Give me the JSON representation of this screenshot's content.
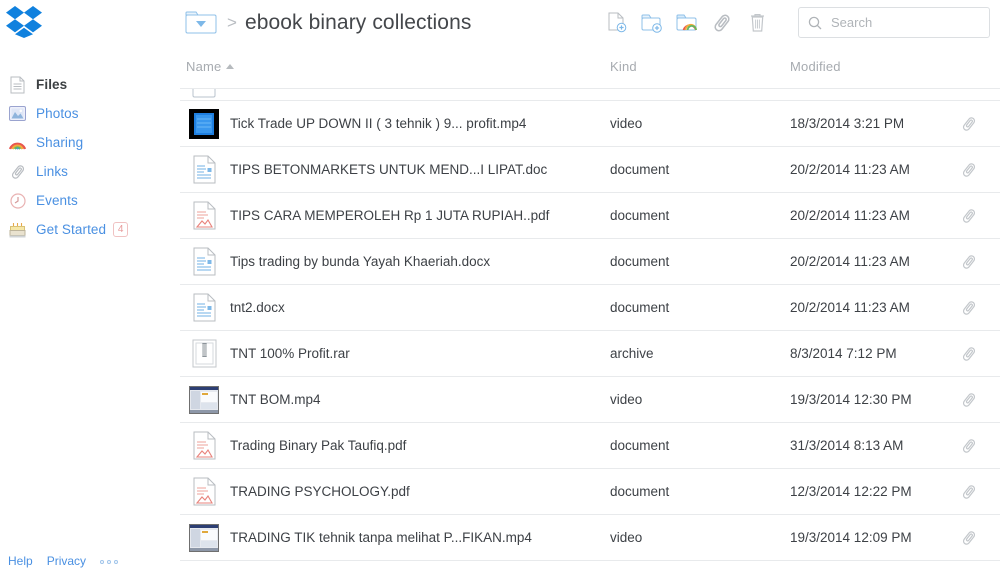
{
  "app": {
    "name": "Dropbox",
    "logo_icon": "dropbox-logo"
  },
  "sidebar": {
    "items": [
      {
        "label": "Files",
        "icon": "file-lines-icon",
        "active": true,
        "badge": null
      },
      {
        "label": "Photos",
        "icon": "photo-icon",
        "active": false,
        "badge": null
      },
      {
        "label": "Sharing",
        "icon": "rainbow-icon",
        "active": false,
        "badge": null
      },
      {
        "label": "Links",
        "icon": "paperclip-icon",
        "active": false,
        "badge": null
      },
      {
        "label": "Events",
        "icon": "clock-icon",
        "active": false,
        "badge": null
      },
      {
        "label": "Get Started",
        "icon": "cake-icon",
        "active": false,
        "badge": "4"
      }
    ]
  },
  "footer": {
    "links": [
      {
        "label": "Help"
      },
      {
        "label": "Privacy"
      }
    ],
    "more_icon": "ellipsis-icon"
  },
  "header": {
    "folder_icon": "folder-dropdown-icon",
    "breadcrumb_separator": ">",
    "title": "ebook binary collections",
    "tools": [
      {
        "name": "new-file-button",
        "icon": "file-plus-icon"
      },
      {
        "name": "new-folder-button",
        "icon": "folder-plus-icon"
      },
      {
        "name": "share-folder-button",
        "icon": "shared-folder-icon"
      },
      {
        "name": "get-link-button",
        "icon": "paperclip-icon"
      },
      {
        "name": "delete-button",
        "icon": "trash-icon"
      }
    ]
  },
  "search": {
    "placeholder": "Search",
    "value": "",
    "icon": "search-icon"
  },
  "table": {
    "columns": [
      {
        "key": "name",
        "label": "Name",
        "sorted": true,
        "sort_dir": "asc"
      },
      {
        "key": "kind",
        "label": "Kind",
        "sorted": false,
        "sort_dir": null
      },
      {
        "key": "modified",
        "label": "Modified",
        "sorted": false,
        "sort_dir": null
      }
    ],
    "rows": [
      {
        "partial": true,
        "icon": "folder-icon",
        "name": "",
        "kind": "",
        "modified": "",
        "clip": false
      },
      {
        "partial": false,
        "icon": "video-thumb-blue",
        "name": "Tick Trade UP DOWN II ( 3 tehnik ) 9... profit.mp4",
        "kind": "video",
        "modified": "18/3/2014 3:21 PM",
        "clip": true
      },
      {
        "partial": false,
        "icon": "doc-blue-icon",
        "name": "TIPS BETONMARKETS UNTUK MEND...I LIPAT.doc",
        "kind": "document",
        "modified": "20/2/2014 11:23 AM",
        "clip": true
      },
      {
        "partial": false,
        "icon": "doc-red-icon",
        "name": "TIPS CARA MEMPEROLEH Rp 1 JUTA RUPIAH..pdf",
        "kind": "document",
        "modified": "20/2/2014 11:23 AM",
        "clip": true
      },
      {
        "partial": false,
        "icon": "doc-blue-icon",
        "name": "Tips trading by bunda Yayah Khaeriah.docx",
        "kind": "document",
        "modified": "20/2/2014 11:23 AM",
        "clip": true
      },
      {
        "partial": false,
        "icon": "doc-blue-icon",
        "name": "tnt2.docx",
        "kind": "document",
        "modified": "20/2/2014 11:23 AM",
        "clip": true
      },
      {
        "partial": false,
        "icon": "archive-icon",
        "name": "TNT 100% Profit.rar",
        "kind": "archive",
        "modified": "8/3/2014 7:12 PM",
        "clip": true
      },
      {
        "partial": false,
        "icon": "video-thumb-desktop",
        "name": "TNT BOM.mp4",
        "kind": "video",
        "modified": "19/3/2014 12:30 PM",
        "clip": true
      },
      {
        "partial": false,
        "icon": "doc-red-icon",
        "name": "Trading Binary Pak Taufiq.pdf",
        "kind": "document",
        "modified": "31/3/2014 8:13 AM",
        "clip": true
      },
      {
        "partial": false,
        "icon": "doc-red-icon",
        "name": "TRADING PSYCHOLOGY.pdf",
        "kind": "document",
        "modified": "12/3/2014 12:22 PM",
        "clip": true
      },
      {
        "partial": false,
        "icon": "video-thumb-desktop",
        "name": "TRADING TIK tehnik tanpa melihat P...FIKAN.mp4",
        "kind": "video",
        "modified": "19/3/2014 12:09 PM",
        "clip": true
      }
    ]
  },
  "colors": {
    "brand_blue": "#1081de",
    "link_blue": "#4a90e2",
    "text": "#3d4146",
    "muted": "#a7abb0",
    "divider": "#e8eaec",
    "badge_red": "#e79a9a"
  }
}
